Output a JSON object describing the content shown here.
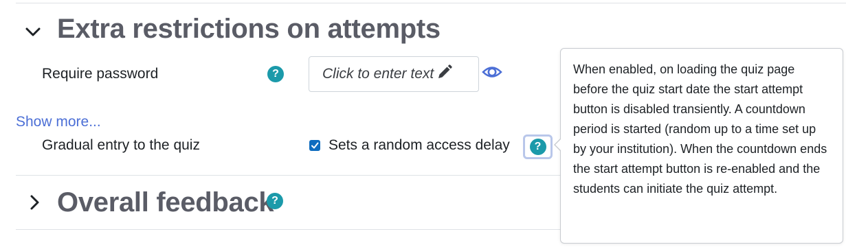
{
  "sections": {
    "extra_restrictions": {
      "title": "Extra restrictions on attempts",
      "expanded": true
    },
    "overall_feedback": {
      "title": "Overall feedback",
      "expanded": false
    }
  },
  "fields": {
    "require_password": {
      "label": "Require password",
      "value": "Click to enter text",
      "help_icon": "?"
    },
    "gradual_entry": {
      "label": "Gradual entry to the quiz",
      "checkbox_label": "Sets a random access delay",
      "checked": true,
      "help_icon": "?"
    }
  },
  "show_more": "Show more...",
  "overall_feedback_help_icon": "?",
  "popover": {
    "text": "When enabled, on loading the quiz page before the quiz start date the start attempt button is disabled transiently. A countdown period is started (random up to a time set up by your institution). When the countdown ends the start attempt button is re-enabled and the students can initiate the quiz attempt."
  },
  "colors": {
    "accent_blue": "#0f6cbf",
    "help_teal": "#1b9aaa",
    "link_blue": "#4c6fd6",
    "heading_grey": "#5a5c66"
  },
  "icons": {
    "section_expanded": "chevron-down-icon",
    "section_collapsed": "chevron-right-icon",
    "edit": "pencil-icon",
    "reveal": "eye-icon"
  }
}
